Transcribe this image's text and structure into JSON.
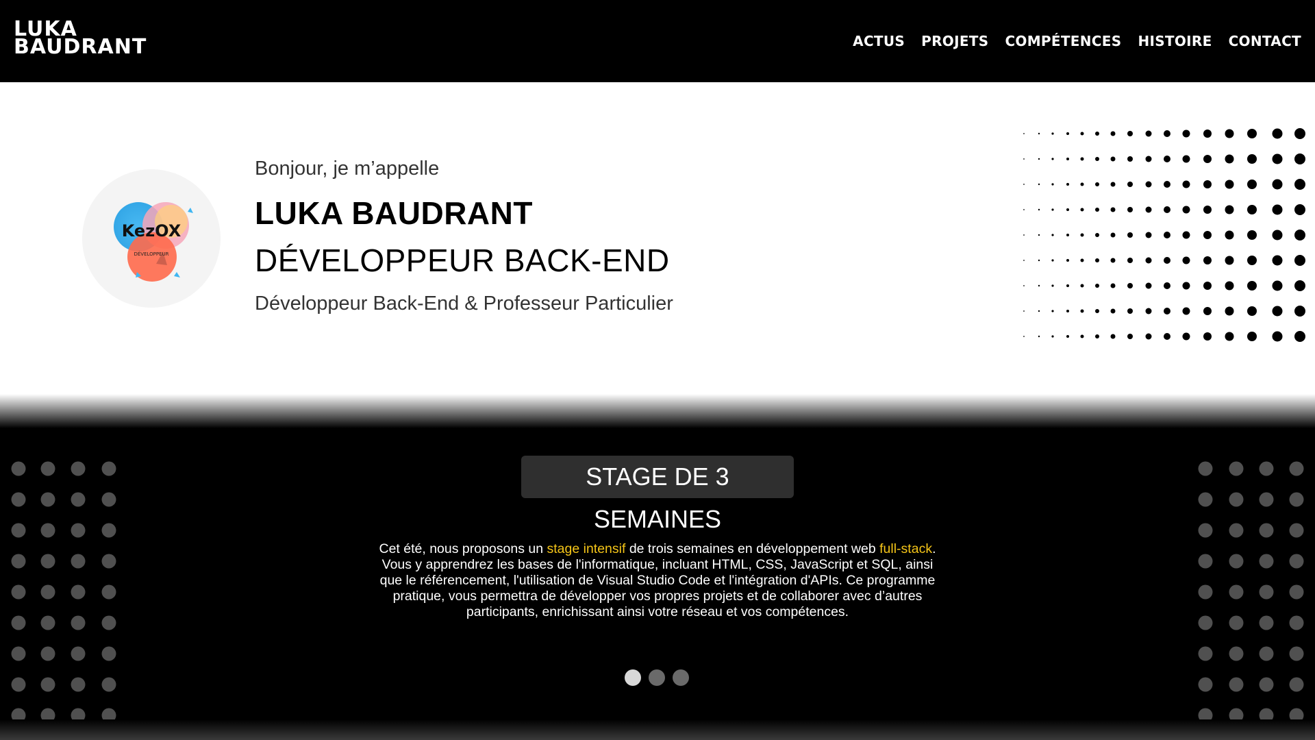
{
  "header": {
    "logo_line1": "LUKA",
    "logo_line2": "BAUDRANT",
    "nav": [
      "ACTUS",
      "PROJETS",
      "COMPÉTENCES",
      "HISTOIRE",
      "CONTACT"
    ]
  },
  "hero": {
    "avatar_text": "KezOX",
    "avatar_subtext": "DÉVELOPPEUR",
    "greeting": "Bonjour, je m’appelle",
    "name": "LUKA BAUDRANT",
    "role": "DÉVELOPPEUR BACK-END",
    "subtitle": "Développeur Back-End & Professeur Particulier"
  },
  "slide": {
    "title": "STAGE DE 3 SEMAINES",
    "text_part1": "Cet été, nous proposons un ",
    "highlight1": "stage intensif",
    "text_part2": " de trois semaines en développement web ",
    "highlight2": "full-stack",
    "text_part3": ". Vous y apprendrez les bases de l'informatique, incluant HTML, CSS, JavaScript et SQL, ainsi que le référencement, l'utilisation de Visual Studio Code et l'intégration d'APIs. Ce programme pratique, vous permettra de développer vos propres projets et de collaborer avec d’autres participants, enrichissant ainsi votre réseau et vos compétences.",
    "dots_total": 3,
    "dots_active": 1
  },
  "colors": {
    "header_bg": "#000000",
    "highlight": "#f5c518",
    "slide_title_bg": "#2f2f2f",
    "side_dot": "#505050"
  }
}
